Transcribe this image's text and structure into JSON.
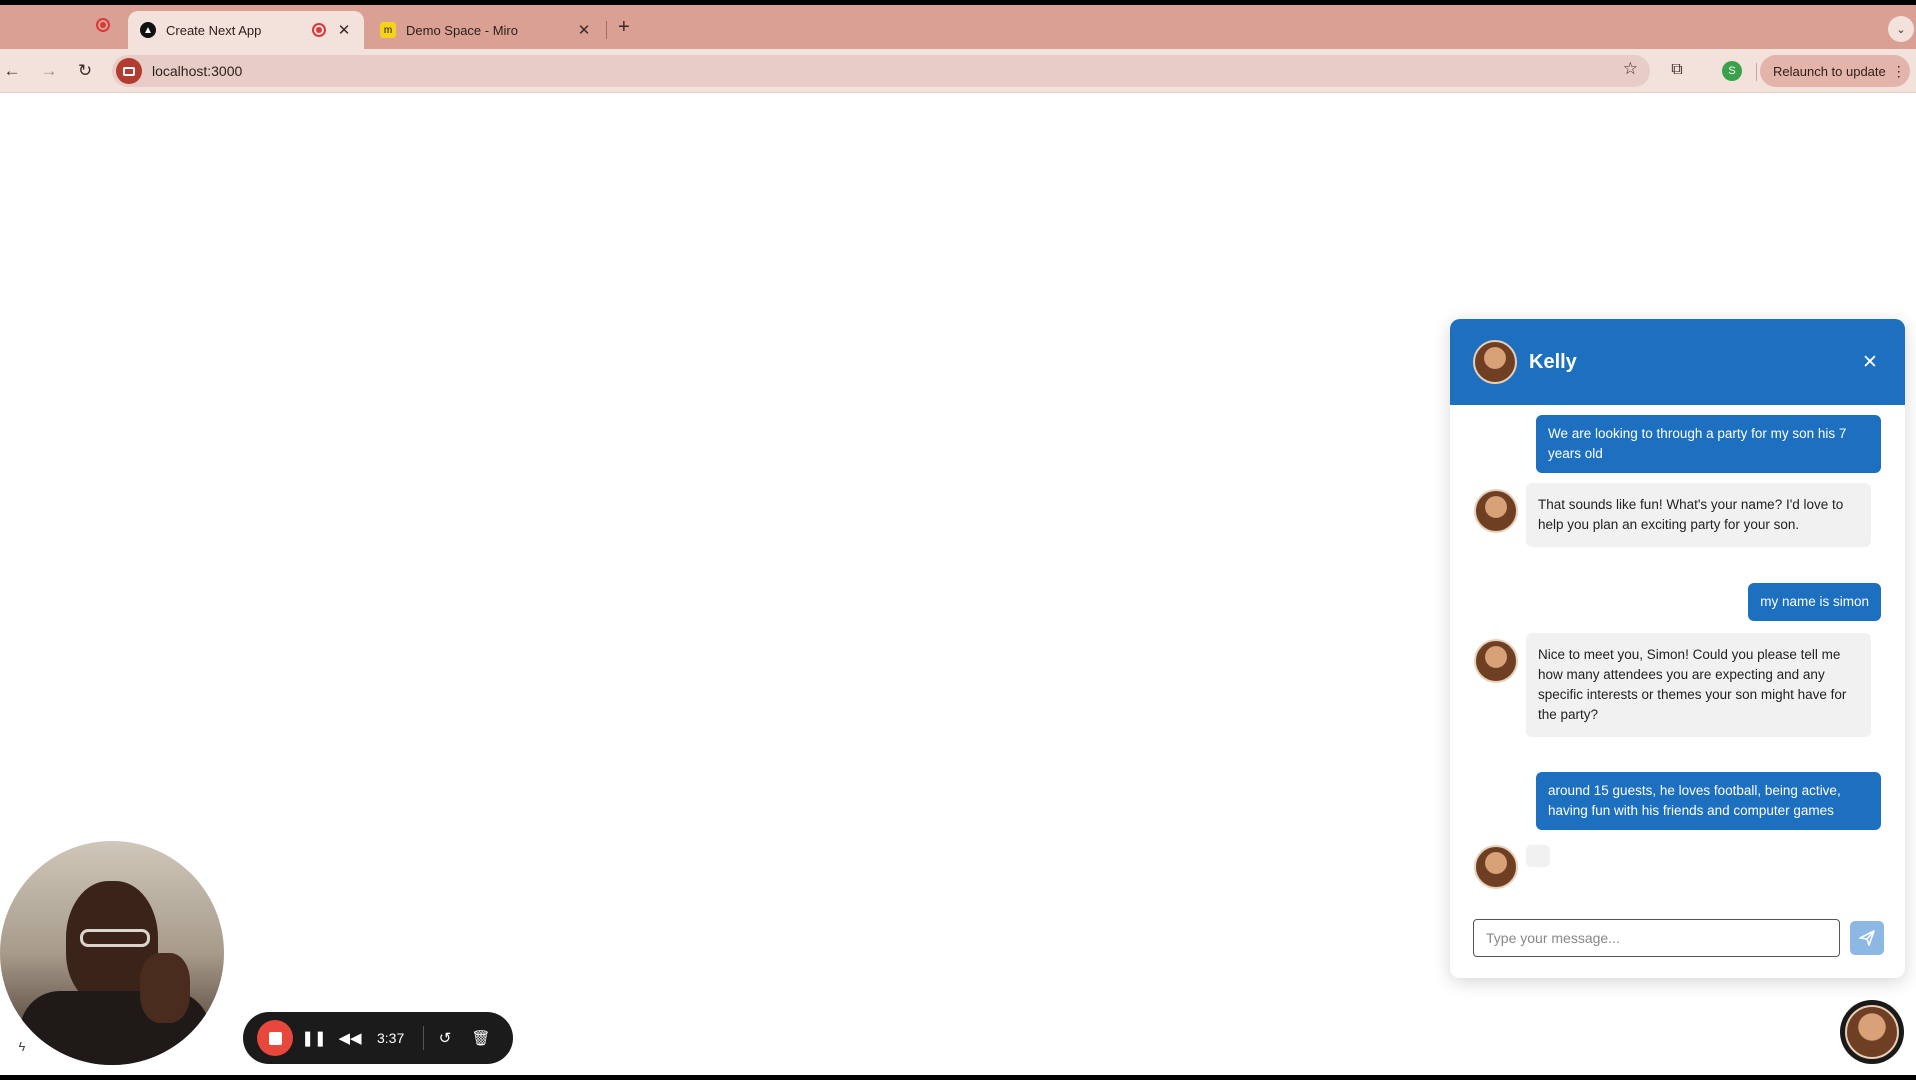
{
  "browser": {
    "tabs": [
      {
        "title": "Create Next App",
        "favicon": "nextjs-icon",
        "recording": true,
        "active": true
      },
      {
        "title": "Demo Space - Miro",
        "favicon": "miro-icon",
        "recording": false,
        "active": false
      }
    ],
    "url": "localhost:3000",
    "profile_initial": "S",
    "relaunch_label": "Relaunch to update"
  },
  "chat": {
    "agent_name": "Kelly",
    "messages": [
      {
        "from": "user",
        "text": "We are looking to through a party for my son his 7 years old"
      },
      {
        "from": "bot",
        "text": "That sounds like fun! What's your name? I'd love to help you plan an exciting party for your son."
      },
      {
        "from": "user",
        "text": "my name is simon"
      },
      {
        "from": "bot",
        "text": "Nice to meet you, Simon! Could you please tell me how many attendees you are expecting and any specific interests or themes your son might have for the party?"
      },
      {
        "from": "user",
        "text": "around 15 guests, he loves football, being active, having fun with his friends and computer games"
      }
    ],
    "input_placeholder": "Type your message...",
    "input_value": ""
  },
  "recorder": {
    "elapsed": "3:37"
  },
  "colors": {
    "tab_strip": "#dba094",
    "toolbar": "#f3e1dc",
    "chat_accent": "#1d6fc0",
    "bot_bubble": "#f1f1f1",
    "record_red": "#e8473c"
  }
}
